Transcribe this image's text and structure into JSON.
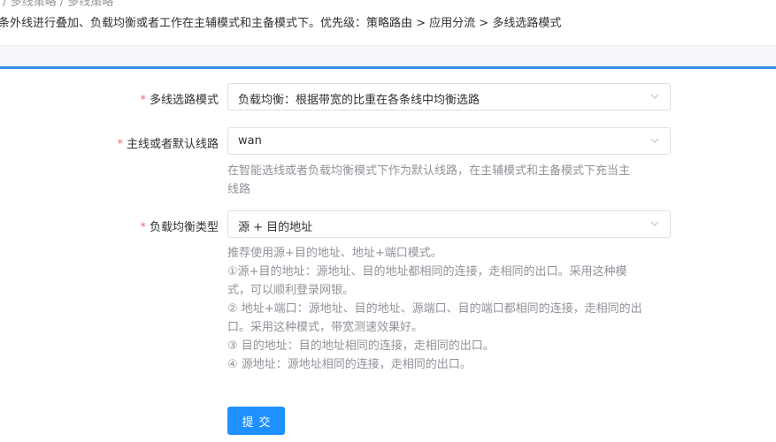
{
  "header": {
    "breadcrumb": "览 / 多线策略 / 多线策略",
    "description": "条外线进行叠加、负载均衡或者工作在主辅模式和主备模式下。优先级：策略路由 > 应用分流 > 多线选路模式"
  },
  "form": {
    "mode": {
      "label": "多线选路模式",
      "value": "负载均衡：根据带宽的比重在各条线中均衡选路"
    },
    "default_line": {
      "label": "主线或者默认线路",
      "value": "wan",
      "help_lines": [
        "在智能选线或者负载均衡模式下作为默认线路，在主辅模式和主备模式下充当主",
        "线路"
      ]
    },
    "balance_type": {
      "label": "负载均衡类型",
      "value": "源 + 目的地址",
      "help_lines": [
        "推荐使用源+目的地址、地址+端口模式。",
        "①源+目的地址：源地址、目的地址都相同的连接，走相同的出口。采用这种模",
        "式，可以顺利登录网银。",
        "② 地址+端口：源地址、目的地址、源端口、目的端口都相同的连接，走相同的出",
        "口。采用这种模式，带宽测速效果好。",
        "③ 目的地址：目的地址相同的连接，走相同的出口。",
        "④ 源地址：源地址相同的连接，走相同的出口。"
      ]
    },
    "required_mark": "*",
    "submit_label": "提交"
  },
  "colors": {
    "accent": "#1e90ff",
    "required": "#f56c6c",
    "help_text": "#909399"
  }
}
